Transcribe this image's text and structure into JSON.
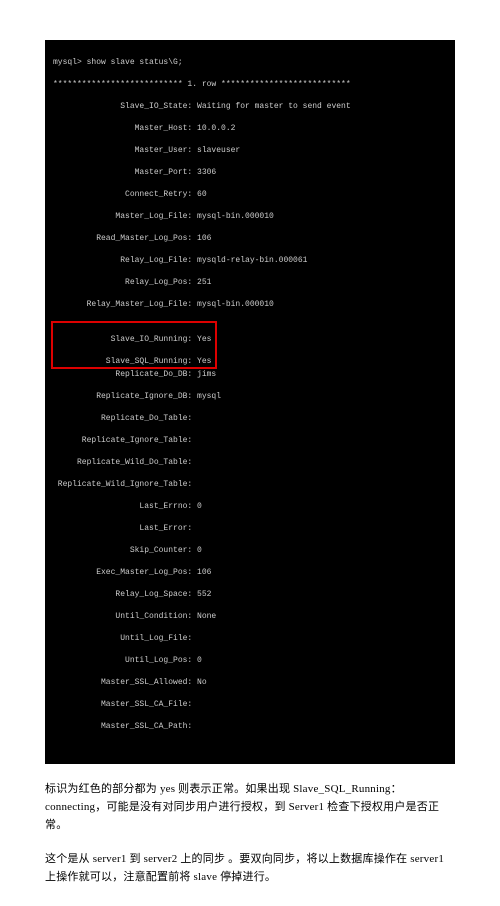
{
  "terminal": {
    "cmd": "mysql> show slave status\\G;",
    "rowheader": "*************************** 1. row ***************************",
    "fields": {
      "slave_io_state": "              Slave_IO_State: Waiting for master to send event",
      "master_host": "                 Master_Host: 10.0.0.2",
      "master_user": "                 Master_User: slaveuser",
      "master_port": "                 Master_Port: 3306",
      "connect_retry": "               Connect_Retry: 60",
      "master_log_file": "             Master_Log_File: mysql-bin.000010",
      "read_master_log_pos": "         Read_Master_Log_Pos: 106",
      "relay_log_file": "              Relay_Log_File: mysqld-relay-bin.000061",
      "relay_log_pos": "               Relay_Log_Pos: 251",
      "relay_master_log_file": "       Relay_Master_Log_File: mysql-bin.000010",
      "slave_io_running": "            Slave_IO_Running: Yes",
      "slave_sql_running": "           Slave_SQL_Running: Yes",
      "replicate_do_db": "             Replicate_Do_DB: jims",
      "replicate_ignore_db": "         Replicate_Ignore_DB: mysql",
      "replicate_do_table": "          Replicate_Do_Table:",
      "replicate_ignore_table": "      Replicate_Ignore_Table:",
      "replicate_wild_do_table": "     Replicate_Wild_Do_Table:",
      "replicate_wild_ignore_table": " Replicate_Wild_Ignore_Table:",
      "last_errno": "                  Last_Errno: 0",
      "last_error": "                  Last_Error:",
      "skip_counter": "                Skip_Counter: 0",
      "exec_master_log_pos": "         Exec_Master_Log_Pos: 106",
      "relay_log_space": "             Relay_Log_Space: 552",
      "until_condition": "             Until_Condition: None",
      "until_log_file": "              Until_Log_File:",
      "until_log_pos": "               Until_Log_Pos: 0",
      "master_ssl_allowed": "          Master_SSL_Allowed: No",
      "master_ssl_ca_file": "          Master_SSL_CA_File:",
      "master_ssl_ca_path": "          Master_SSL_CA_Path:"
    }
  },
  "para1": "标识为红色的部分都为 yes 则表示正常。如果出现 Slave_SQL_Running：connecting，可能是没有对同步用户进行授权，到 Server1 检查下授权用户是否正常。",
  "para2": "这个是从 server1 到 server2 上的同步 。要双向同步，将以上数据库操作在 server1 上操作就可以，注意配置前将 slave 停掉进行。"
}
